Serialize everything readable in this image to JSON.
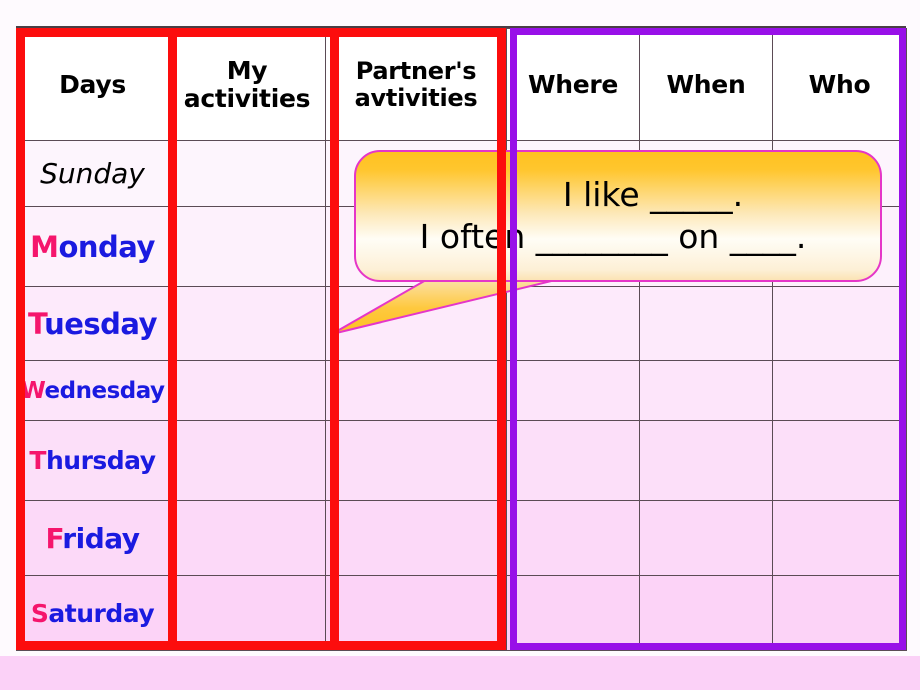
{
  "page": {
    "background_color": "#fbd1f7",
    "sheet_color": "#fefafe"
  },
  "table": {
    "headers": [
      {
        "id": "days",
        "label": "Days"
      },
      {
        "id": "my",
        "label": "My\nactivities"
      },
      {
        "id": "partner",
        "label": "Partner's\navtivities"
      },
      {
        "id": "where",
        "label": "Where"
      },
      {
        "id": "when",
        "label": "When"
      },
      {
        "id": "who",
        "label": "Who"
      }
    ],
    "header_labels": {
      "days": "Days",
      "my_line1": "My",
      "my_line2": "activities",
      "partner_line1": "Partner's",
      "partner_line2": "avtivities",
      "where": "Where",
      "when": "When",
      "who": "Who"
    },
    "rows": [
      {
        "day": "Sunday",
        "initial": "S",
        "rest": "unday",
        "style": "italic-black",
        "my": "",
        "partner": "",
        "where": "",
        "when": "",
        "who": ""
      },
      {
        "day": "Monday",
        "initial": "M",
        "rest": "onday",
        "style": "two-tone",
        "my": "",
        "partner": "",
        "where": "",
        "when": "",
        "who": ""
      },
      {
        "day": "Tuesday",
        "initial": "T",
        "rest": "uesday",
        "style": "two-tone",
        "my": "",
        "partner": "",
        "where": "",
        "when": "",
        "who": ""
      },
      {
        "day": "Wednesday",
        "initial": "W",
        "rest": "ednesday",
        "style": "two-tone",
        "my": "",
        "partner": "",
        "where": "",
        "when": "",
        "who": ""
      },
      {
        "day": "Thursday",
        "initial": "T",
        "rest": "hursday",
        "style": "two-tone",
        "my": "",
        "partner": "",
        "where": "",
        "when": "",
        "who": ""
      },
      {
        "day": "Friday",
        "initial": "F",
        "rest": "riday",
        "style": "two-tone",
        "my": "",
        "partner": "",
        "where": "",
        "when": "",
        "who": ""
      },
      {
        "day": "Saturday",
        "initial": "S",
        "rest": "aturday",
        "style": "two-tone",
        "my": "",
        "partner": "",
        "where": "",
        "when": "",
        "who": ""
      }
    ],
    "colors": {
      "red_box": "#fc0d0d",
      "purple_box": "#9810e8",
      "grid_line": "#5b4b55",
      "day_initial": "#f5156c",
      "day_rest": "#1a1ae0",
      "header_text": "#000000"
    }
  },
  "speech_bubble": {
    "line1": "I like _____.",
    "line2": "I often ________ on ____.",
    "fill_top": "#ffc220",
    "fill_bottom": "#fffdf6",
    "outline": "#e536c8"
  }
}
